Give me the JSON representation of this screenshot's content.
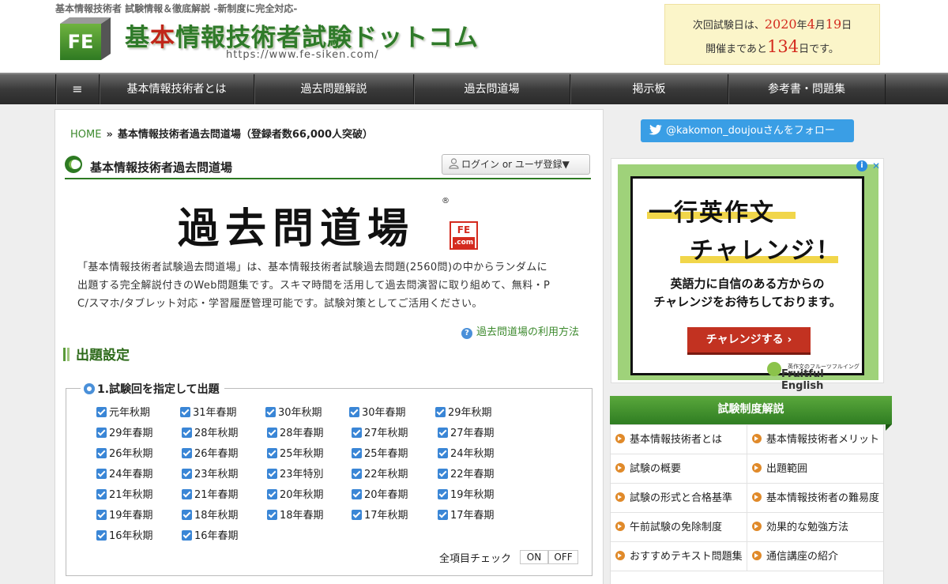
{
  "header": {
    "tagline": "基本情報技術者 試験情報＆徹底解説 -新制度に完全対応-",
    "logo_text_pre": "基",
    "logo_text_red": "本",
    "logo_text_post": "情報技術者試験ドットコム",
    "logo_badge": "FE",
    "url": "https://www.fe-siken.com/",
    "exam": {
      "line1_prefix": "次回試験日は、",
      "year": "2020",
      "year_suffix": "年",
      "month": "4",
      "month_suffix": "月",
      "day": "19",
      "day_suffix": "日",
      "line2_prefix": "開催まであと",
      "days_left": "134",
      "line2_suffix": "日です。"
    }
  },
  "nav": {
    "menu_icon": "≡",
    "items": [
      "基本情報技術者とは",
      "過去問題解説",
      "過去問道場",
      "掲示板",
      "参考書・問題集"
    ]
  },
  "breadcrumb": {
    "home": "HOME",
    "separator": "»",
    "current": "基本情報技術者過去問道場（登録者数66,000人突破）"
  },
  "section": {
    "title": "基本情報技術者過去問道場",
    "login_label": "ログイン or ユーザ登録▼"
  },
  "dojo_logo": {
    "kanji": "過去問道場",
    "registered": "®",
    "badge_top": "FE",
    "badge_bottom": ".com"
  },
  "intro": {
    "line1": "「基本情報技術者試験過去問道場」は、基本情報技術者試験過去問題(2560問)の中からランダムに",
    "line2": "出題する完全解説付きのWeb問題集です。スキマ時間を活用して過去問演習に取り組めて、無料・P",
    "line3": "C/スマホ/タブレット対応・学習履歴管理可能です。試験対策としてご活用ください。"
  },
  "howto": {
    "icon": "?",
    "label": "過去問道場の利用方法"
  },
  "settings": {
    "title": "出題設定",
    "group_title": "1.試験回を指定して出題",
    "options": [
      [
        "元年秋期",
        "31年春期",
        "30年秋期",
        "30年春期",
        "29年秋期"
      ],
      [
        "29年春期",
        "28年秋期",
        "28年春期",
        "27年秋期",
        "27年春期"
      ],
      [
        "26年秋期",
        "26年春期",
        "25年秋期",
        "25年春期",
        "24年秋期"
      ],
      [
        "24年春期",
        "23年秋期",
        "23年特別",
        "22年秋期",
        "22年春期"
      ],
      [
        "21年秋期",
        "21年春期",
        "20年秋期",
        "20年春期",
        "19年秋期"
      ],
      [
        "19年春期",
        "18年秋期",
        "18年春期",
        "17年秋期",
        "17年春期"
      ],
      [
        "16年秋期",
        "16年春期"
      ]
    ],
    "all_check_label": "全項目チェック",
    "on_label": "ON",
    "off_label": "OFF"
  },
  "sidebar": {
    "twitter_label": "@kakomon_doujouさんをフォロー",
    "ad": {
      "headline1": "一行英作文",
      "headline2": "チャレンジ！",
      "sub1": "英語力に自信のある方からの",
      "sub2": "チャレンジをお待ちしております。",
      "button": "チャレンジする ›",
      "brand_small": "英作文のフルーツフルイングリッシュ",
      "brand": "Fruitful English",
      "info_icon": "i",
      "close_icon": "✕"
    },
    "section_title": "試験制度解説",
    "items": [
      "基本情報技術者とは",
      "基本情報技術者メリット",
      "試験の概要",
      "出題範囲",
      "試験の形式と合格基準",
      "基本情報技術者の難易度",
      "午前試験の免除制度",
      "効果的な勉強方法",
      "おすすめテキスト問題集",
      "通信講座の紹介"
    ]
  },
  "colors": {
    "brand_green": "#2d7a22",
    "link_green": "#3d8a2e",
    "accent_red": "#d42b1f",
    "checkbox_blue": "#3a86d6",
    "twitter_blue": "#3a9ee5"
  }
}
